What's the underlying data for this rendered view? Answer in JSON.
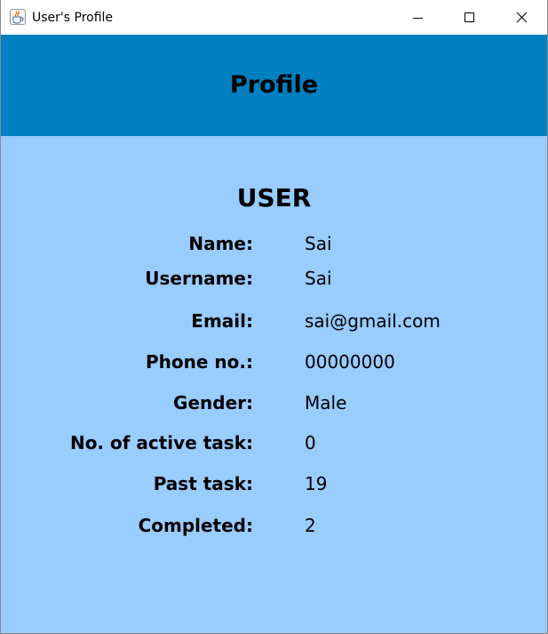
{
  "window": {
    "title": "User's Profile",
    "app_icon": "java-coffee-icon",
    "controls": {
      "minimize_icon": "minimize-icon",
      "maximize_icon": "maximize-icon",
      "close_icon": "close-icon"
    }
  },
  "header": {
    "title": "Profile",
    "background_color": "#007fc1"
  },
  "profile": {
    "section_title": "USER",
    "background_color": "#99ccff",
    "fields": [
      {
        "label": "Name:",
        "value": "Sai"
      },
      {
        "label": "Username:",
        "value": "Sai"
      },
      {
        "label": "Email:",
        "value": "sai@gmail.com"
      },
      {
        "label": "Phone no.:",
        "value": "00000000"
      },
      {
        "label": "Gender:",
        "value": "Male"
      },
      {
        "label": "No. of active task:",
        "value": "0"
      },
      {
        "label": "Past task:",
        "value": "19"
      },
      {
        "label": "Completed:",
        "value": "2"
      }
    ]
  }
}
